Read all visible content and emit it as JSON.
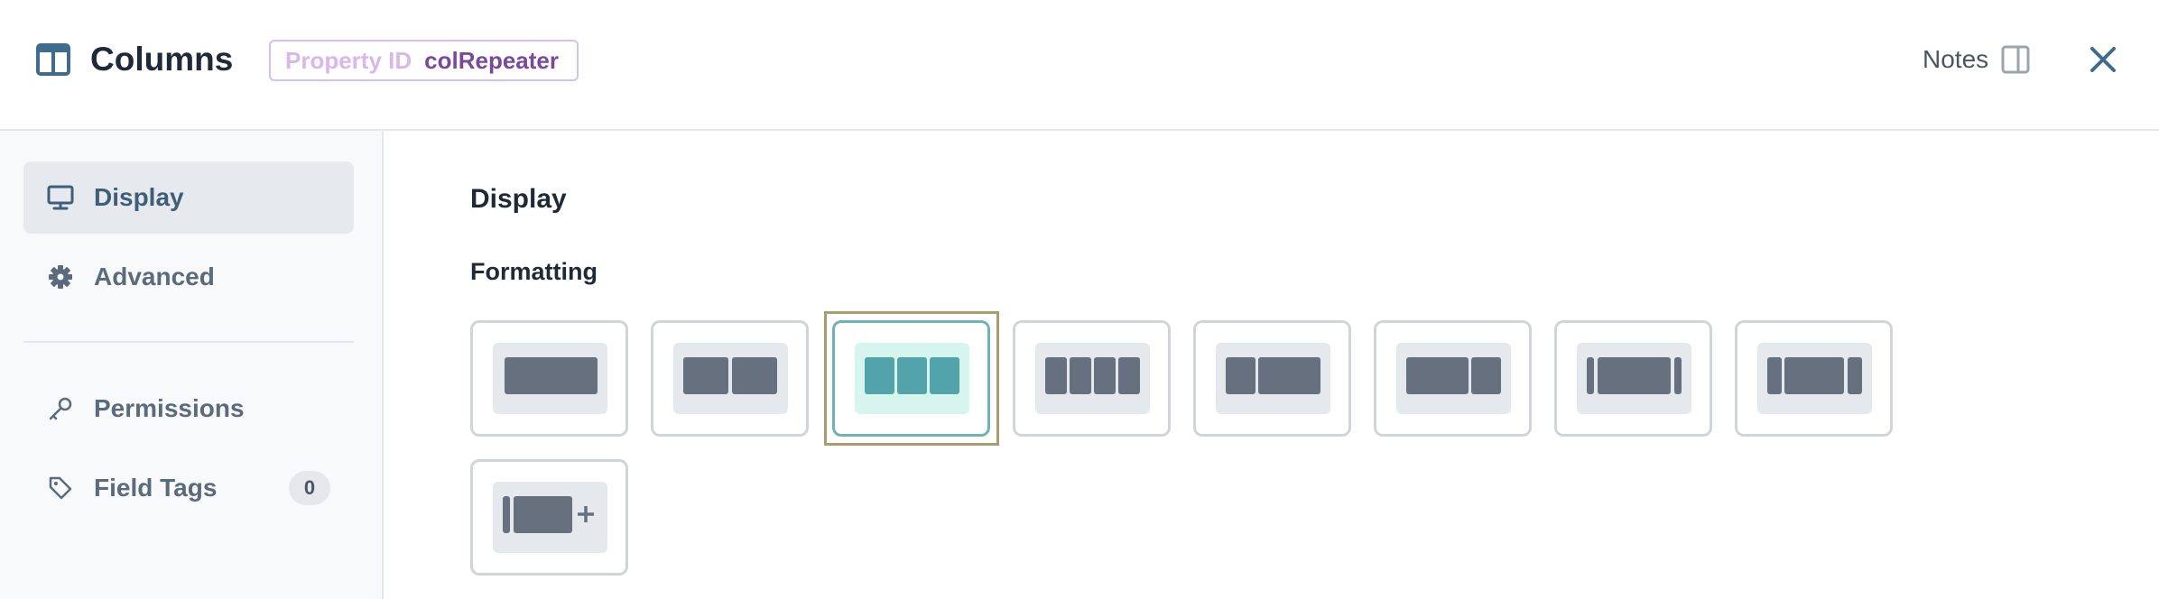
{
  "header": {
    "title": "Columns",
    "title_icon": "columns-icon",
    "property_id_label": "Property ID",
    "property_id_value": "colRepeater",
    "notes_label": "Notes",
    "notes_icon": "sidebar-panel-icon",
    "close_icon": "close-icon"
  },
  "sidebar": {
    "items": [
      {
        "label": "Display",
        "icon": "monitor-icon",
        "active": true
      },
      {
        "label": "Advanced",
        "icon": "gear-icon"
      },
      {
        "label": "Permissions",
        "icon": "key-icon"
      },
      {
        "label": "Field Tags",
        "icon": "tag-icon",
        "count": "0"
      }
    ]
  },
  "main": {
    "section_title": "Display",
    "formatting_label": "Formatting",
    "layout_options": [
      {
        "name": "one-column"
      },
      {
        "name": "two-columns"
      },
      {
        "name": "three-columns",
        "selected": true
      },
      {
        "name": "four-columns"
      },
      {
        "name": "narrow-wide"
      },
      {
        "name": "wide-narrow"
      },
      {
        "name": "sidebar-wide-sidebar"
      },
      {
        "name": "sidebar-wide-narrow"
      },
      {
        "name": "repeater-add"
      }
    ]
  },
  "colors": {
    "accent": "#52a3aa",
    "selected_fill": "#d5f5ee",
    "block": "#66707f"
  }
}
